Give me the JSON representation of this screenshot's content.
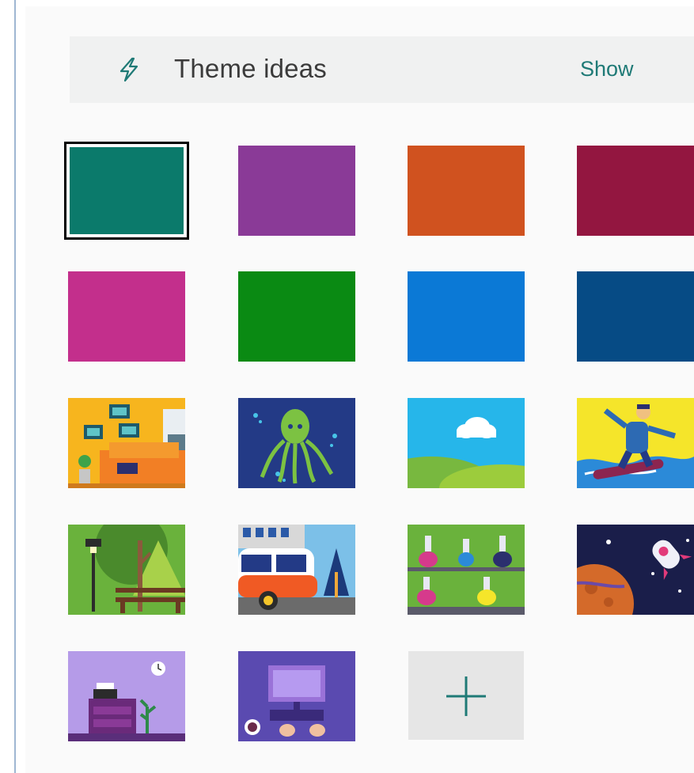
{
  "theme_ideas": {
    "title": "Theme ideas",
    "show_label": "Show",
    "icon": "lightning-bolt-icon",
    "accent": "#1f7a76"
  },
  "color_swatches": [
    {
      "name": "teal",
      "color": "#0b7a6b",
      "selected": true
    },
    {
      "name": "purple",
      "color": "#8a3a97",
      "selected": false
    },
    {
      "name": "orange",
      "color": "#d0521f",
      "selected": false
    },
    {
      "name": "crimson",
      "color": "#931640",
      "selected": false
    },
    {
      "name": "magenta",
      "color": "#c32f8c",
      "selected": false
    },
    {
      "name": "green",
      "color": "#0a8a13",
      "selected": false
    },
    {
      "name": "blue",
      "color": "#0b79d6",
      "selected": false
    },
    {
      "name": "navy",
      "color": "#064b85",
      "selected": false
    }
  ],
  "image_themes": [
    "living-room",
    "octopus",
    "landscape-cloud",
    "snowboarder",
    "park-bench",
    "city-bus",
    "lab-flasks",
    "space-rocket",
    "typewriter-desk",
    "keyboard-computer"
  ],
  "add_button": {
    "icon": "plus-icon",
    "accent": "#1f7a76"
  }
}
